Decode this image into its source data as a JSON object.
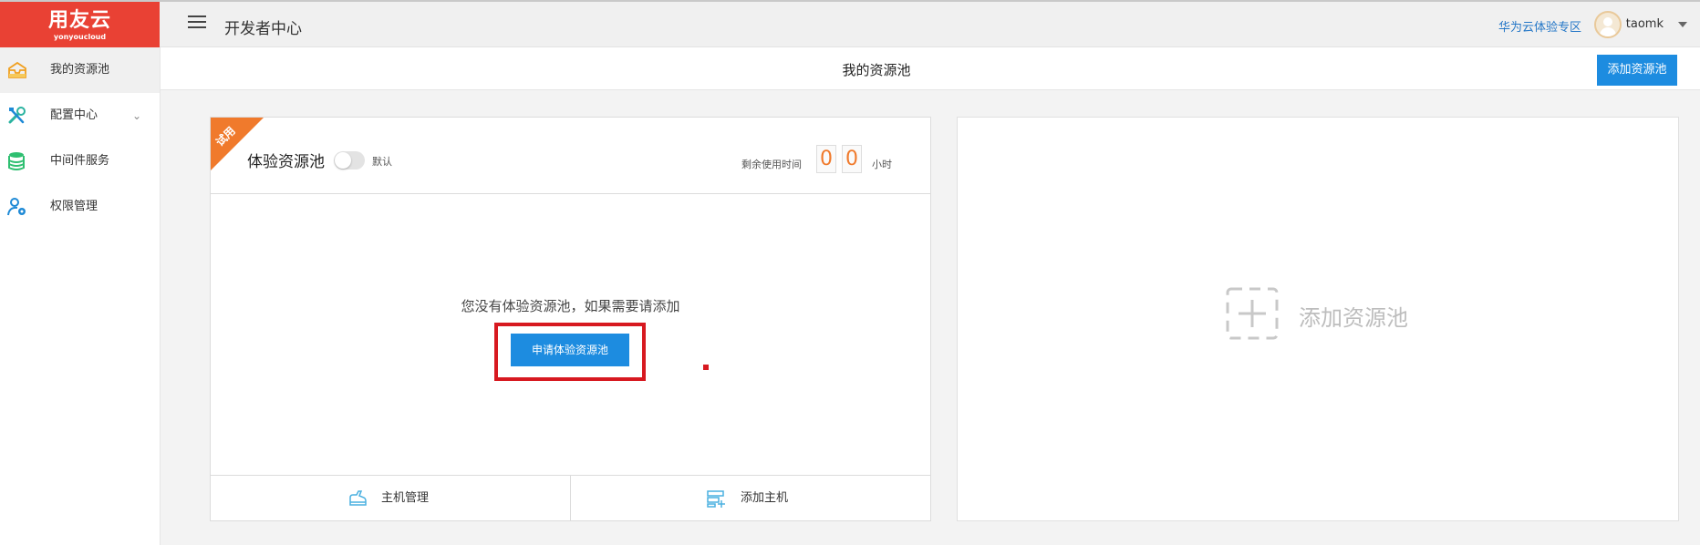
{
  "header": {
    "logo_text": "用友云",
    "logo_sub": "yonyoucloud",
    "app_title": "开发者中心",
    "huawei_link": "华为云体验专区",
    "username": "taomk"
  },
  "sidebar": {
    "items": [
      {
        "label": "我的资源池",
        "icon": "inbox-icon",
        "active": true
      },
      {
        "label": "配置中心",
        "icon": "tools-icon",
        "has_submenu": true
      },
      {
        "label": "中间件服务",
        "icon": "database-icon"
      },
      {
        "label": "权限管理",
        "icon": "user-gear-icon"
      }
    ],
    "chevron": "⌄"
  },
  "subheader": {
    "title": "我的资源池",
    "add_button": "添加资源池"
  },
  "pool_card": {
    "ribbon": "试用",
    "title": "体验资源池",
    "toggle_on": false,
    "default_label": "默认",
    "remaining_label": "剩余使用时间",
    "digits": [
      "0",
      "0"
    ],
    "hour_label": "小时",
    "empty_message": "您没有体验资源池，如果需要请添加",
    "apply_button": "申请体验资源池",
    "footer": {
      "host_manage": "主机管理",
      "add_host": "添加主机"
    }
  },
  "add_card": {
    "label": "添加资源池"
  },
  "colors": {
    "brand_red": "#e94134",
    "primary_blue": "#1d8ce0",
    "trial_orange": "#f07a2c",
    "highlight_red": "#d71920"
  }
}
